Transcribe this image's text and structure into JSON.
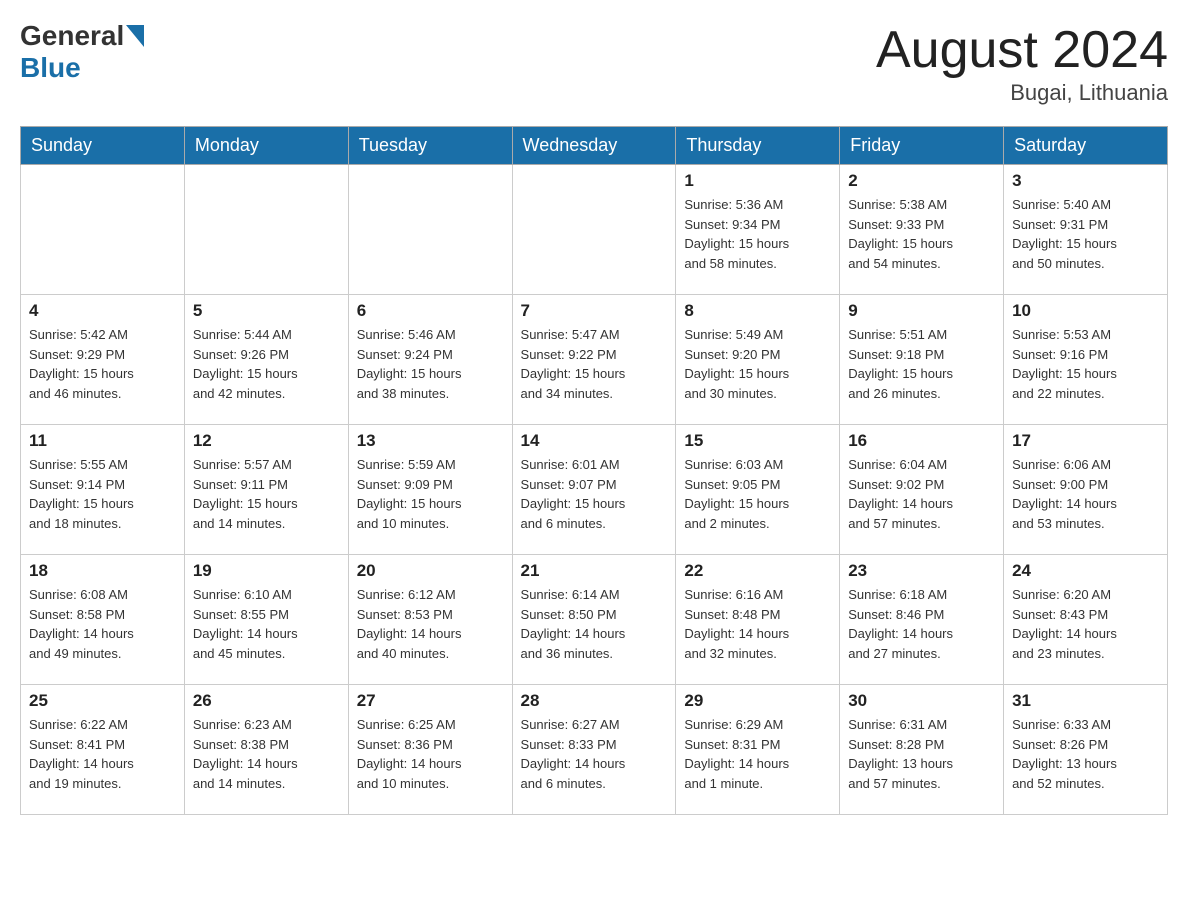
{
  "header": {
    "logo_general": "General",
    "logo_blue": "Blue",
    "month_title": "August 2024",
    "location": "Bugai, Lithuania"
  },
  "weekdays": [
    "Sunday",
    "Monday",
    "Tuesday",
    "Wednesday",
    "Thursday",
    "Friday",
    "Saturday"
  ],
  "weeks": [
    [
      {
        "day": "",
        "info": ""
      },
      {
        "day": "",
        "info": ""
      },
      {
        "day": "",
        "info": ""
      },
      {
        "day": "",
        "info": ""
      },
      {
        "day": "1",
        "info": "Sunrise: 5:36 AM\nSunset: 9:34 PM\nDaylight: 15 hours\nand 58 minutes."
      },
      {
        "day": "2",
        "info": "Sunrise: 5:38 AM\nSunset: 9:33 PM\nDaylight: 15 hours\nand 54 minutes."
      },
      {
        "day": "3",
        "info": "Sunrise: 5:40 AM\nSunset: 9:31 PM\nDaylight: 15 hours\nand 50 minutes."
      }
    ],
    [
      {
        "day": "4",
        "info": "Sunrise: 5:42 AM\nSunset: 9:29 PM\nDaylight: 15 hours\nand 46 minutes."
      },
      {
        "day": "5",
        "info": "Sunrise: 5:44 AM\nSunset: 9:26 PM\nDaylight: 15 hours\nand 42 minutes."
      },
      {
        "day": "6",
        "info": "Sunrise: 5:46 AM\nSunset: 9:24 PM\nDaylight: 15 hours\nand 38 minutes."
      },
      {
        "day": "7",
        "info": "Sunrise: 5:47 AM\nSunset: 9:22 PM\nDaylight: 15 hours\nand 34 minutes."
      },
      {
        "day": "8",
        "info": "Sunrise: 5:49 AM\nSunset: 9:20 PM\nDaylight: 15 hours\nand 30 minutes."
      },
      {
        "day": "9",
        "info": "Sunrise: 5:51 AM\nSunset: 9:18 PM\nDaylight: 15 hours\nand 26 minutes."
      },
      {
        "day": "10",
        "info": "Sunrise: 5:53 AM\nSunset: 9:16 PM\nDaylight: 15 hours\nand 22 minutes."
      }
    ],
    [
      {
        "day": "11",
        "info": "Sunrise: 5:55 AM\nSunset: 9:14 PM\nDaylight: 15 hours\nand 18 minutes."
      },
      {
        "day": "12",
        "info": "Sunrise: 5:57 AM\nSunset: 9:11 PM\nDaylight: 15 hours\nand 14 minutes."
      },
      {
        "day": "13",
        "info": "Sunrise: 5:59 AM\nSunset: 9:09 PM\nDaylight: 15 hours\nand 10 minutes."
      },
      {
        "day": "14",
        "info": "Sunrise: 6:01 AM\nSunset: 9:07 PM\nDaylight: 15 hours\nand 6 minutes."
      },
      {
        "day": "15",
        "info": "Sunrise: 6:03 AM\nSunset: 9:05 PM\nDaylight: 15 hours\nand 2 minutes."
      },
      {
        "day": "16",
        "info": "Sunrise: 6:04 AM\nSunset: 9:02 PM\nDaylight: 14 hours\nand 57 minutes."
      },
      {
        "day": "17",
        "info": "Sunrise: 6:06 AM\nSunset: 9:00 PM\nDaylight: 14 hours\nand 53 minutes."
      }
    ],
    [
      {
        "day": "18",
        "info": "Sunrise: 6:08 AM\nSunset: 8:58 PM\nDaylight: 14 hours\nand 49 minutes."
      },
      {
        "day": "19",
        "info": "Sunrise: 6:10 AM\nSunset: 8:55 PM\nDaylight: 14 hours\nand 45 minutes."
      },
      {
        "day": "20",
        "info": "Sunrise: 6:12 AM\nSunset: 8:53 PM\nDaylight: 14 hours\nand 40 minutes."
      },
      {
        "day": "21",
        "info": "Sunrise: 6:14 AM\nSunset: 8:50 PM\nDaylight: 14 hours\nand 36 minutes."
      },
      {
        "day": "22",
        "info": "Sunrise: 6:16 AM\nSunset: 8:48 PM\nDaylight: 14 hours\nand 32 minutes."
      },
      {
        "day": "23",
        "info": "Sunrise: 6:18 AM\nSunset: 8:46 PM\nDaylight: 14 hours\nand 27 minutes."
      },
      {
        "day": "24",
        "info": "Sunrise: 6:20 AM\nSunset: 8:43 PM\nDaylight: 14 hours\nand 23 minutes."
      }
    ],
    [
      {
        "day": "25",
        "info": "Sunrise: 6:22 AM\nSunset: 8:41 PM\nDaylight: 14 hours\nand 19 minutes."
      },
      {
        "day": "26",
        "info": "Sunrise: 6:23 AM\nSunset: 8:38 PM\nDaylight: 14 hours\nand 14 minutes."
      },
      {
        "day": "27",
        "info": "Sunrise: 6:25 AM\nSunset: 8:36 PM\nDaylight: 14 hours\nand 10 minutes."
      },
      {
        "day": "28",
        "info": "Sunrise: 6:27 AM\nSunset: 8:33 PM\nDaylight: 14 hours\nand 6 minutes."
      },
      {
        "day": "29",
        "info": "Sunrise: 6:29 AM\nSunset: 8:31 PM\nDaylight: 14 hours\nand 1 minute."
      },
      {
        "day": "30",
        "info": "Sunrise: 6:31 AM\nSunset: 8:28 PM\nDaylight: 13 hours\nand 57 minutes."
      },
      {
        "day": "31",
        "info": "Sunrise: 6:33 AM\nSunset: 8:26 PM\nDaylight: 13 hours\nand 52 minutes."
      }
    ]
  ]
}
